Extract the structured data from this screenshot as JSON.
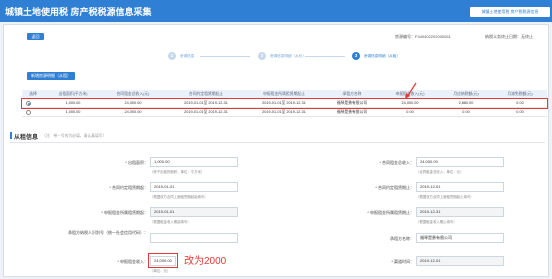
{
  "header": {
    "title": "城镇土地使用税 房产税税源信息采集",
    "nav_button": "城镇土地使用税 房产税税源信息"
  },
  "toolbar": {
    "back_label": "返回",
    "doc_no": "房源编号：F440402202000051",
    "doc_status": "纳税义务终止日期：无终止"
  },
  "steps": [
    {
      "num": "1",
      "label": "房源信息"
    },
    {
      "num": "2",
      "label": "房源信息明细（从价）"
    },
    {
      "num": "3",
      "label": "房源信息明细（从租）"
    }
  ],
  "add_button": "新增房源明细（从租）",
  "table": {
    "headers": [
      "选择",
      "出租面积(平方米)",
      "合同租金总收入(元)",
      "合同约定租赁期起止",
      "申报租金所属租赁期起止",
      "承租方名称",
      "申报租金收入(元)",
      "月应纳税额(元)",
      "月减免税额(元)"
    ],
    "rows": [
      {
        "selected": true,
        "area": "1,000.00",
        "total": "24,000.00",
        "period": "2019-01-01至 2019-12-31",
        "decl_period": "2019-01-01至 2019-12-31",
        "tenant": "福琴是勇有限公司",
        "rent": "24,000.00",
        "monthly_tax": "2,880.00",
        "monthly_relief": "0.00"
      },
      {
        "selected": false,
        "area": "1,000.00",
        "total": "24,000.00",
        "period": "2019-01-01至 2019-12-31",
        "decl_period": "2019-01-01至 2019-12-31",
        "tenant": "福琴是勇有限公司",
        "rent": "0.00",
        "monthly_tax": "0.00",
        "monthly_relief": "0.00"
      }
    ]
  },
  "section": {
    "title": "从租信息",
    "note": "（注：带 * 号的为必填，请认真填写）"
  },
  "form": {
    "area_label": "* 出租面积：",
    "area_value": "1,000.00",
    "area_hint": "（房子出租的面积，单位：平方米）",
    "total_label": "* 合同租金总收入：",
    "total_value": "24,000.00",
    "total_hint": "（合同租金总收入，单位：元）",
    "start_label": "* 合同约定租赁期起：",
    "start_value": "2019-01-01",
    "start_hint": "（根据双方合同上面租赁期起始填写）",
    "end_label": "* 合同约定租赁期止：",
    "end_value": "2019-12-01",
    "end_hint": "（根据双方合同上面租赁期起止填写）",
    "decl_start_label": "* 申报租金所属租赁期起：",
    "decl_start_value": "2019-01-01",
    "decl_start_hint": "（根据租金收入期起填写）",
    "decl_end_label": "* 申报租金所属租赁期止：",
    "decl_end_value": "2019-12-31",
    "decl_end_hint": "（根据租金收入期止填写）",
    "tenant_id_label": "承租方纳税人识别号（统一社会信用代码）：",
    "tenant_id_value": "",
    "tenant_name_label": "承租方名称：",
    "tenant_name_value": "福琴是勇有限公司",
    "rent_label": "* 申报租金收入：",
    "rent_value": "24,000.00",
    "rent_hint": "（单位：元）",
    "date_label": "* 渠道时间：",
    "date_value": "2019-12-01"
  },
  "annotation": "改为2000"
}
